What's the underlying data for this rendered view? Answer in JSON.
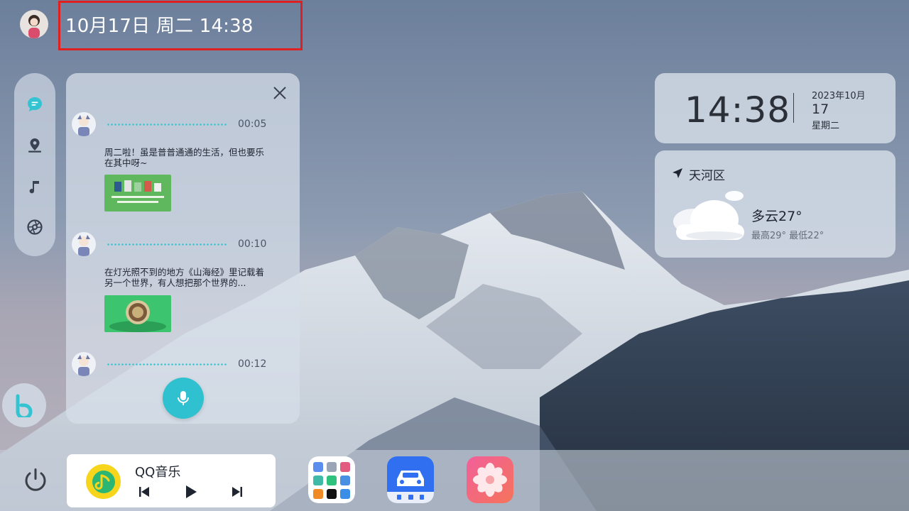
{
  "status": {
    "datetime": "10月17日 周二 14:38"
  },
  "clock": {
    "time": "14:38",
    "year_month": "2023年10月",
    "day": "17",
    "weekday": "星期二"
  },
  "weather": {
    "location": "天河区",
    "current": "多云27°",
    "range": "最高29° 最低22°"
  },
  "chat": {
    "messages": [
      {
        "duration": "00:05",
        "text": "周二啦！虽是普普通通的生活，但也要乐在其中呀~"
      },
      {
        "duration": "00:10",
        "text": "在灯光照不到的地方《山海经》里记载着另一个世界，有人想把那个世界的..."
      },
      {
        "duration": "00:12"
      }
    ]
  },
  "music": {
    "app_name": "QQ音乐"
  },
  "icons": {
    "chat": "chat-bubble-icon",
    "location": "location-pin-icon",
    "music": "music-note-icon",
    "aperture": "aperture-icon",
    "close": "close-icon",
    "mic": "microphone-icon",
    "power": "power-icon"
  },
  "colors": {
    "accent": "#2fc1cf",
    "highlight_border": "#e02020",
    "qq_yellow": "#f7d51d"
  }
}
